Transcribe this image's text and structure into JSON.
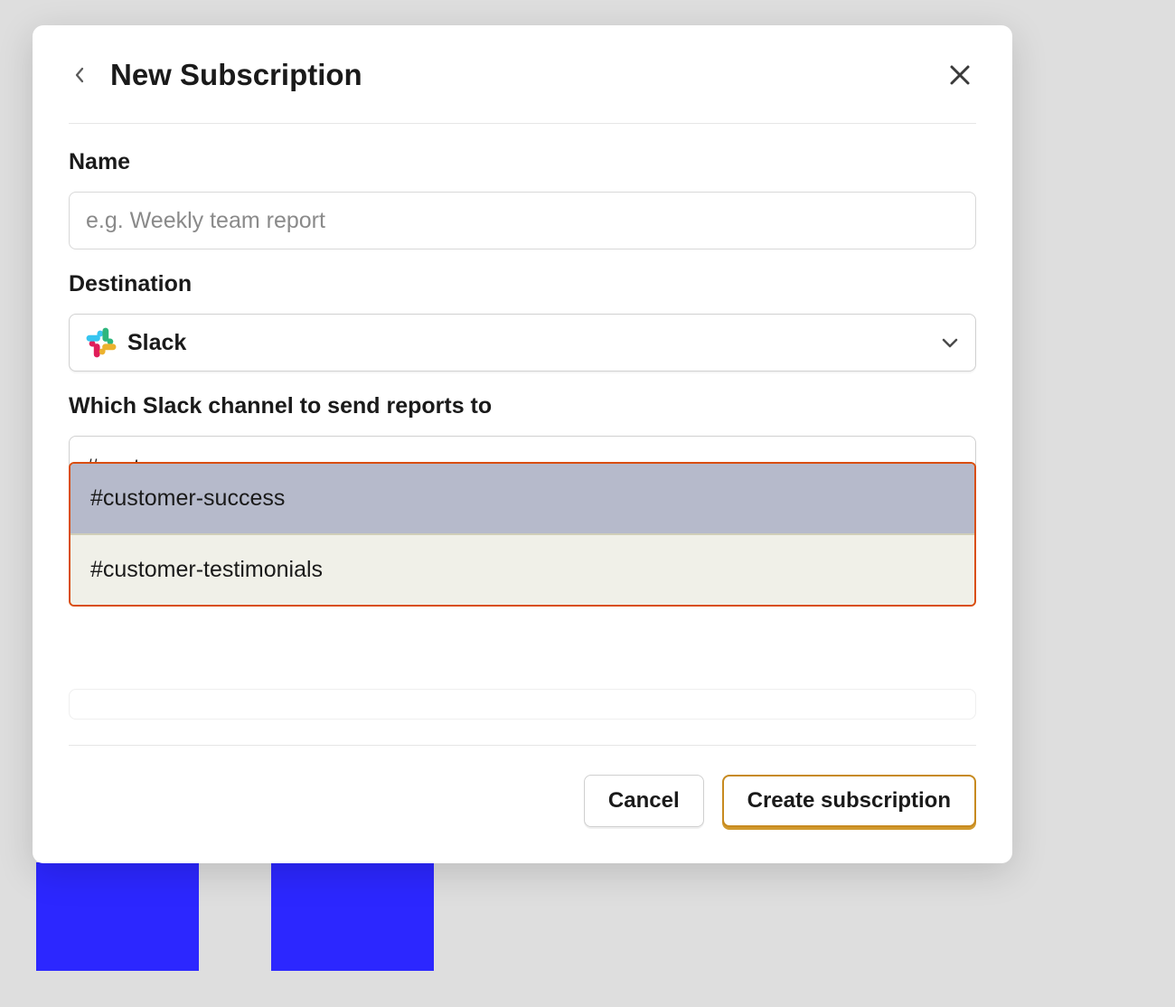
{
  "modal": {
    "title": "New Subscription",
    "name_label": "Name",
    "name_placeholder": "e.g. Weekly team report",
    "name_value": "",
    "destination_label": "Destination",
    "destination_value": "Slack",
    "channel_label": "Which Slack channel to send reports to",
    "channel_value": "#cust",
    "dropdown_items": [
      {
        "label": "#customer-success",
        "highlighted": true
      },
      {
        "label": "#customer-testimonials",
        "highlighted": false
      }
    ],
    "cancel_label": "Cancel",
    "submit_label": "Create subscription"
  }
}
